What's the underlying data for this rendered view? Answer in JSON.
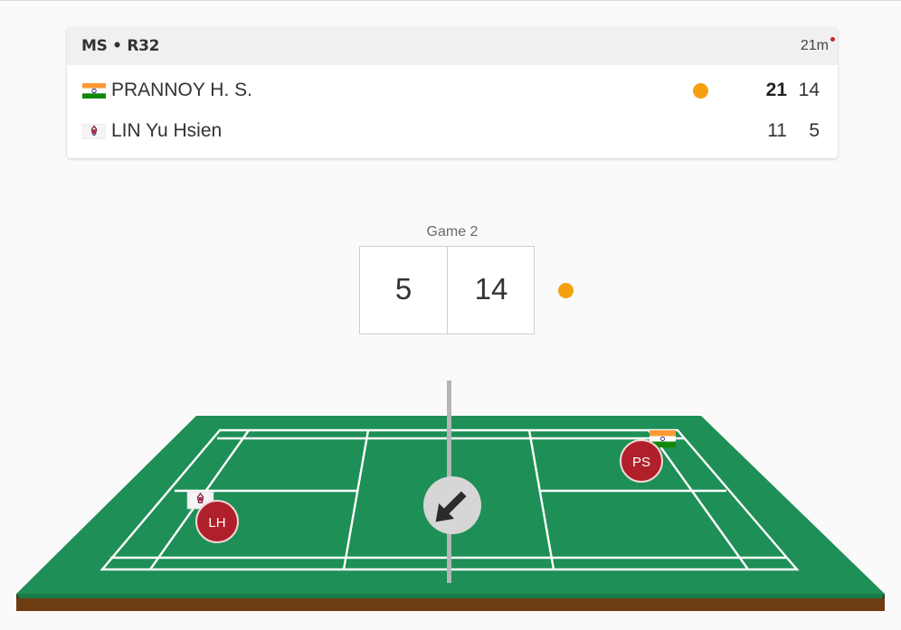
{
  "match": {
    "round": "MS • R32",
    "elapsed": "21m"
  },
  "players": [
    {
      "name": "PRANNOY H. S.",
      "country_flag": "india-flag-icon",
      "serving": true,
      "games": [
        "21",
        "14"
      ],
      "game1_won": true,
      "initials": "PS"
    },
    {
      "name": "LIN Yu Hsien",
      "country_flag": "chinese-taipei-flag-icon",
      "serving": false,
      "games": [
        "11",
        "5"
      ],
      "game1_won": false,
      "initials": "LH"
    }
  ],
  "current_game": {
    "label": "Game 2",
    "left_score": "5",
    "right_score": "14"
  },
  "colors": {
    "court_green": "#1e8f56",
    "court_dark": "#15683c",
    "court_base": "#6e3c13",
    "serve_dot": "#f5a10f",
    "player_marker": "#b0202b",
    "live_dot": "#c1272d"
  },
  "shuttle_direction_icon": "arrow-down-left-icon"
}
